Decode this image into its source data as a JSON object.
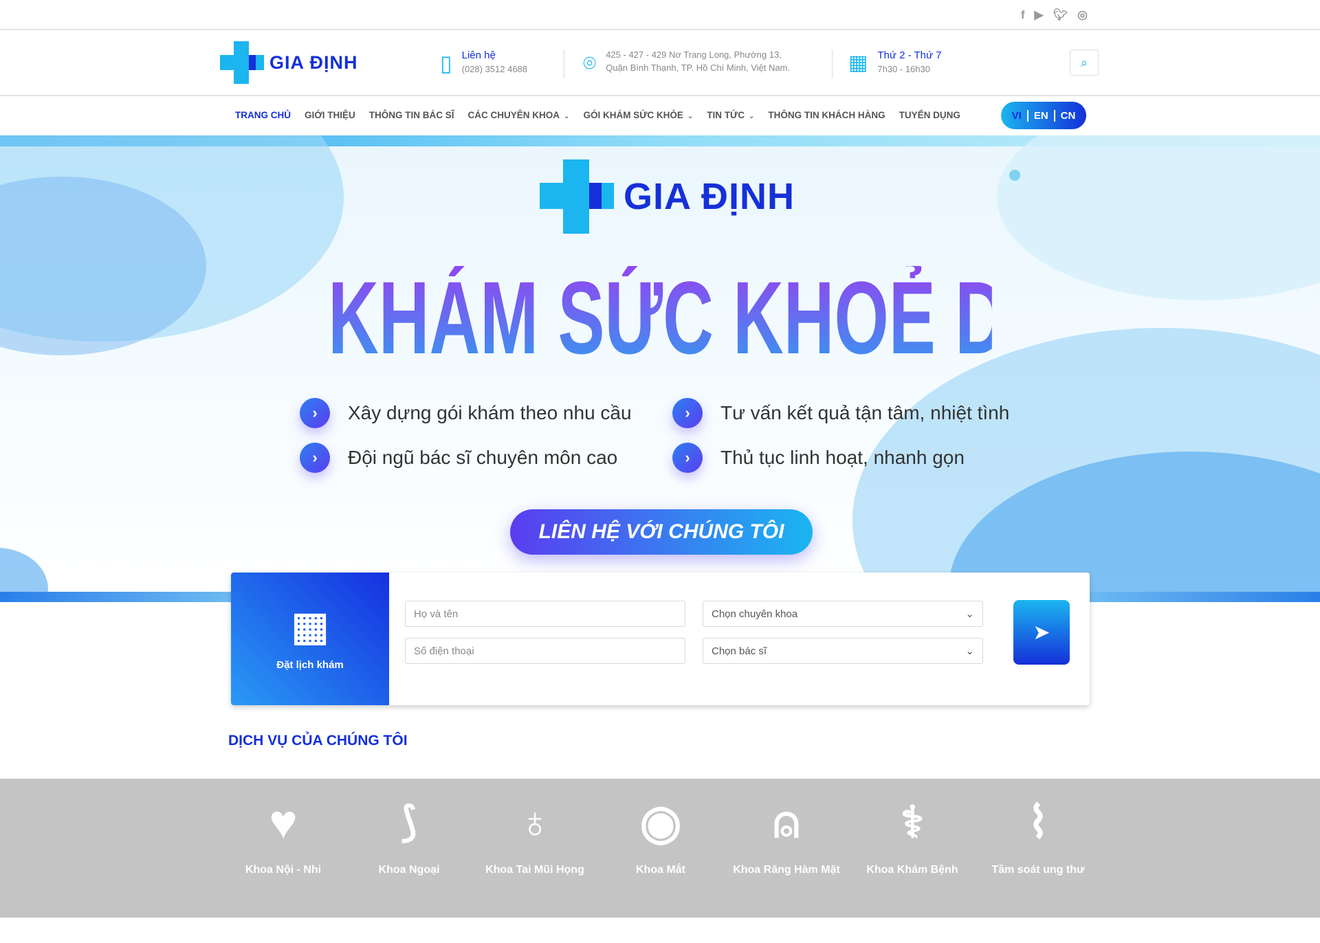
{
  "social": [
    "facebook-icon",
    "youtube-icon",
    "twitter-icon",
    "instagram-icon"
  ],
  "logo": {
    "text": "GIA ĐỊNH"
  },
  "header": {
    "contact": {
      "label": "Liên hệ",
      "phone": "(028) 3512 4688"
    },
    "address": {
      "line1": "425 - 427 - 429 Nơ Trang Long, Phường 13,",
      "line2": "Quận Bình Thạnh, TP. Hồ Chí Minh, Việt Nam."
    },
    "hours": {
      "days": "Thứ 2 - Thứ 7",
      "time": "7h30 - 16h30"
    }
  },
  "nav": {
    "items": [
      {
        "label": "TRANG CHỦ",
        "active": true
      },
      {
        "label": "GIỚI THIỆU"
      },
      {
        "label": "THÔNG TIN BÁC SĨ"
      },
      {
        "label": "CÁC CHUYÊN KHOA",
        "dropdown": true
      },
      {
        "label": "GÓI KHÁM SỨC KHỎE",
        "dropdown": true
      },
      {
        "label": "TIN TỨC",
        "dropdown": true
      },
      {
        "label": "THÔNG TIN KHÁCH HÀNG"
      },
      {
        "label": "TUYỂN DỤNG"
      }
    ],
    "languages": [
      "VI",
      "EN",
      "CN"
    ]
  },
  "hero": {
    "title": "KHÁM SỨC KHOẺ DOANH NGHIỆP",
    "bullets": [
      "Xây dựng gói khám theo nhu cầu",
      "Tư vấn kết quả tận tâm, nhiệt tình",
      "Đội ngũ bác sĩ chuyên môn cao",
      "Thủ tục linh hoạt, nhanh gọn"
    ],
    "cta": "LIÊN HỆ VỚI CHÚNG TÔI"
  },
  "booking": {
    "label": "Đặt lịch khám",
    "name_placeholder": "Họ và tên",
    "phone_placeholder": "Số điện thoại",
    "specialty": "Chọn chuyên khoa",
    "doctor": "Chọn bác sĩ"
  },
  "services": {
    "title": "DỊCH VỤ CỦA CHÚNG TÔI",
    "items": [
      "Khoa Nội - Nhi",
      "Khoa Ngoại",
      "Khoa Tai Mũi Họng",
      "Khoa Mắt",
      "Khoa Răng Hàm Mặt",
      "Khoa Khám Bệnh",
      "Tầm soát ung thư"
    ]
  },
  "colors": {
    "brand": "#1530d8",
    "accent": "#1bb5f0",
    "services_bg": "#c4c4c4"
  }
}
